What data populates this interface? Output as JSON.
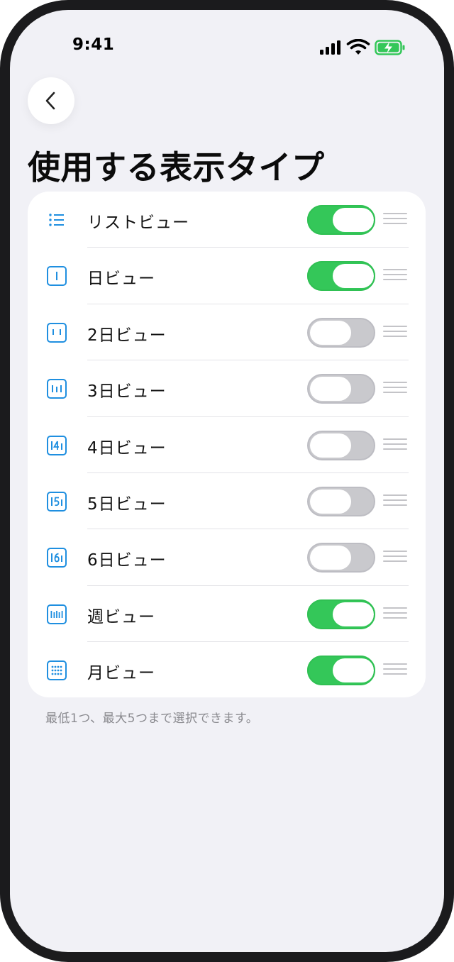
{
  "status_bar": {
    "time": "9:41",
    "icons": [
      "signal-icon",
      "wifi-icon",
      "battery-charging-icon"
    ]
  },
  "nav": {
    "back_icon": "chevron-left-icon"
  },
  "page": {
    "title": "使用する表示タイプ"
  },
  "colors": {
    "toggle_on": "#34c759",
    "toggle_off": "#c9c9cd",
    "icon_accent": "#1f8fe0",
    "background": "#f1f1f6"
  },
  "views": [
    {
      "label": "リストビュー",
      "icon": "list-icon",
      "enabled": true
    },
    {
      "label": "日ビュー",
      "icon": "day-view-icon",
      "enabled": true
    },
    {
      "label": "2日ビュー",
      "icon": "two-day-view-icon",
      "enabled": false
    },
    {
      "label": "3日ビュー",
      "icon": "three-day-view-icon",
      "enabled": false
    },
    {
      "label": "4日ビュー",
      "icon": "four-day-view-icon",
      "enabled": false
    },
    {
      "label": "5日ビュー",
      "icon": "five-day-view-icon",
      "enabled": false
    },
    {
      "label": "6日ビュー",
      "icon": "six-day-view-icon",
      "enabled": false
    },
    {
      "label": "週ビュー",
      "icon": "week-view-icon",
      "enabled": true
    },
    {
      "label": "月ビュー",
      "icon": "month-view-icon",
      "enabled": true
    }
  ],
  "footnote": "最低1つ、最大5つまで選択できます。"
}
